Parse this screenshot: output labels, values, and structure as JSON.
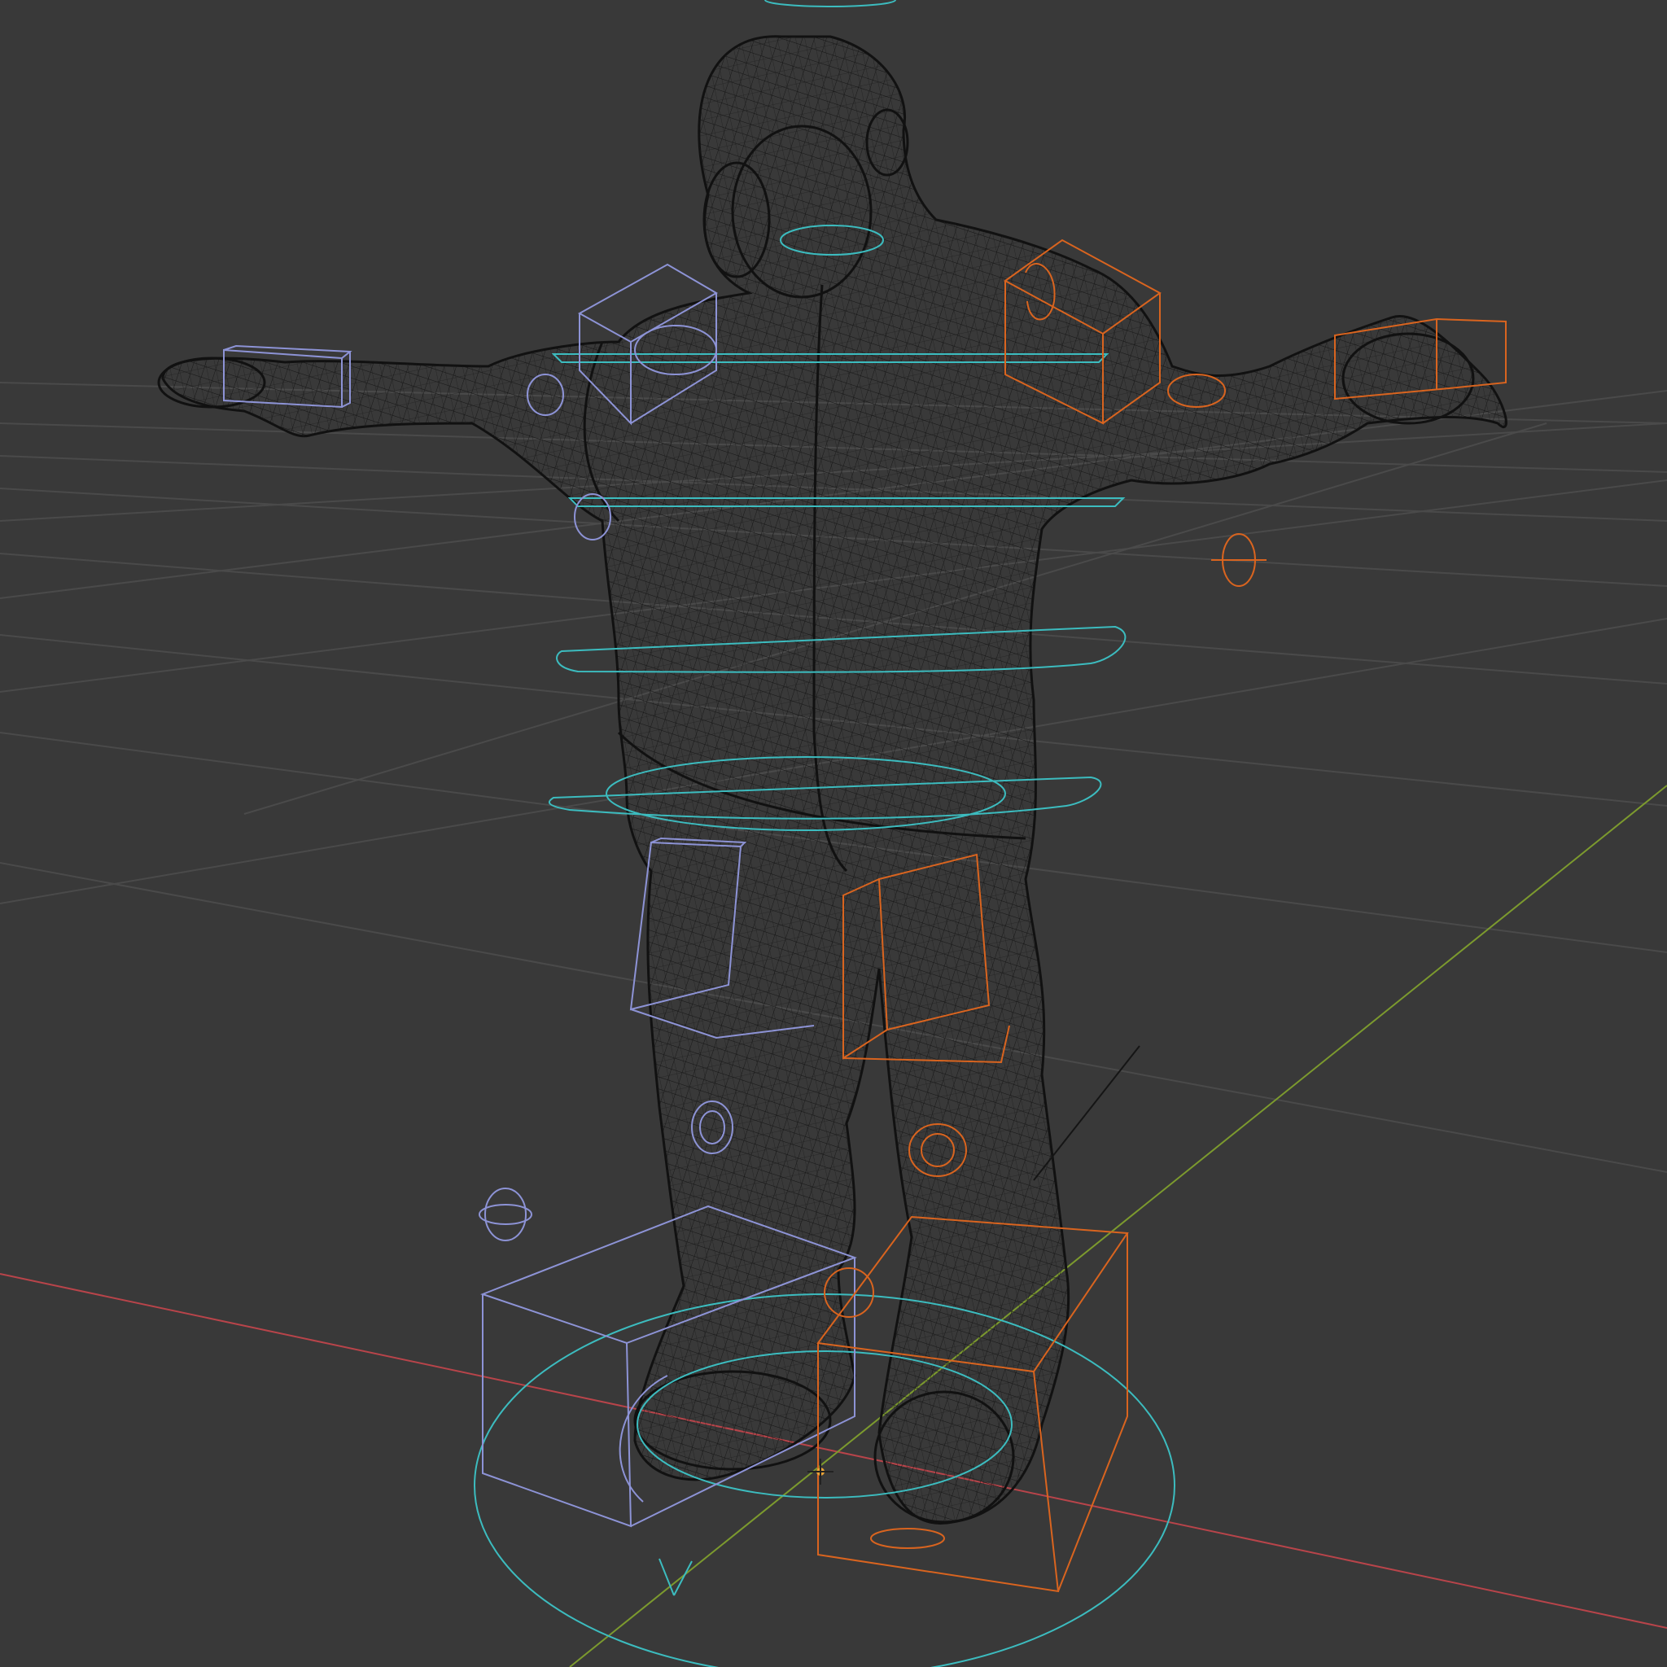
{
  "viewport": {
    "name": "3D Viewport",
    "shading_mode": "wireframe",
    "background_color": "#393939"
  },
  "colors": {
    "grid_line": "#4a4a4a",
    "axis_x": "#b8444a",
    "axis_y": "#7c9a2e",
    "mesh_wire": "#151515",
    "bone_left": "#8d93d6",
    "bone_right": "#d9641f",
    "bone_center": "#3cbcbf",
    "origin_dot": "#e8a237"
  },
  "scene": {
    "mesh": "character-body",
    "armature_controls": [
      "head-circle",
      "neck-circle",
      "shoulder-circle",
      "chest-circle",
      "spine-circle",
      "hips-circle",
      "root-circle",
      "hand-ik-l",
      "hand-ik-r",
      "shoulder-ik-l",
      "shoulder-ik-r",
      "elbow-pole-l",
      "elbow-pole-r",
      "thigh-ik-l",
      "thigh-ik-r",
      "knee-pole-l",
      "knee-pole-r",
      "foot-ik-l",
      "foot-ik-r",
      "foot-pole-l",
      "foot-pole-r"
    ]
  }
}
